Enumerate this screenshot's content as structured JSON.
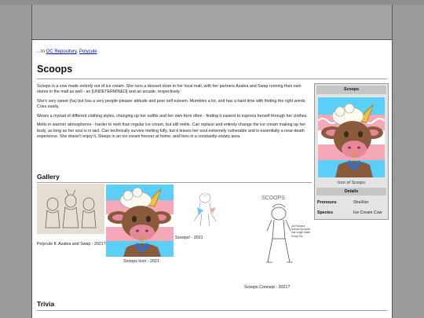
{
  "breadcrumb": {
    "prefix": "...In ",
    "links": [
      "OC Repository",
      "Polycule"
    ],
    "separator": ", "
  },
  "page": {
    "title": "Scoops"
  },
  "description": [
    "Scoops is a cow made entirely out of ice cream. She runs a dessert store in her local mall, with her partners Azalea and Swap running their own stores in the mall as well - an [UNDETERMINED] and an arcade, respectively.",
    "She's very sweet (ha) but has a very people-pleaser attitude and poor self esteem. Mumbles a lot, and has a hard time with finding the right words. Cries easily.",
    "Wears a myriad of different clothing styles, changing up her outfits and her own form often - finding it easiest to express herself through her clothes.",
    "Melts in warmer atmospheres - harder to melt than regular ice cream, but still melts. Can replace and entirely change the ice cream making up her body, as long as her soul is in tact. Can technically survive melting fully, but it leaves her soul extremely vulnerable and is essentially a near-death experience. She doesn't enjoy it. Sleeps in an ice cream freezer at home, and lives in a constantly-snowy area."
  ],
  "gallery": {
    "heading": "Gallery",
    "items": [
      {
        "caption": "Polycule ft. Azalea and Swap - 2021?"
      },
      {
        "caption": "Scoops Icon - 2021"
      },
      {
        "caption": "Scoops! - 2021"
      },
      {
        "caption": "Scoops Concept - 2021?"
      }
    ]
  },
  "trivia": {
    "heading": "Trivia"
  },
  "infobox": {
    "title": "Scoops",
    "caption": "Icon of Scoops",
    "details_heading": "Details",
    "rows": [
      {
        "key": "Pronouns",
        "value": "She/Her"
      },
      {
        "key": "Species",
        "value": "Ice Cream Cow"
      }
    ]
  },
  "sketch_text": {
    "title": "SCOOPS",
    "notes": "are Rumahs Natural Sprinkles that hedge Wafer Scoop Etc"
  },
  "colors": {
    "link": "#0b0bd4",
    "header_bar": "#a4a4a4",
    "infobox_bg": "#e4e4e4",
    "trans_blue": "#5bcefa",
    "trans_pink": "#f5a9b8",
    "cow_fur": "#8a5a3c",
    "cow_muzzle": "#e8879a",
    "horn": "#f0c040"
  }
}
